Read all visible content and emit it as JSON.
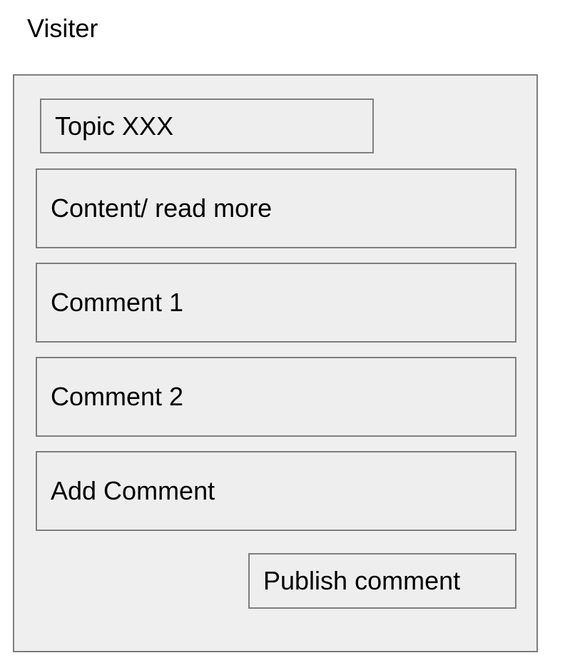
{
  "page": {
    "label": "Visiter"
  },
  "topic": {
    "title": "Topic XXX"
  },
  "content": {
    "label": "Content/ read more"
  },
  "comments": [
    {
      "label": "Comment 1"
    },
    {
      "label": "Comment 2"
    }
  ],
  "add_comment": {
    "label": "Add Comment"
  },
  "publish": {
    "label": "Publish comment"
  },
  "colors": {
    "border": "#7f7f7f",
    "panel_fill": "#efefef",
    "box_fill": "#eeeeee",
    "text": "#000000"
  }
}
